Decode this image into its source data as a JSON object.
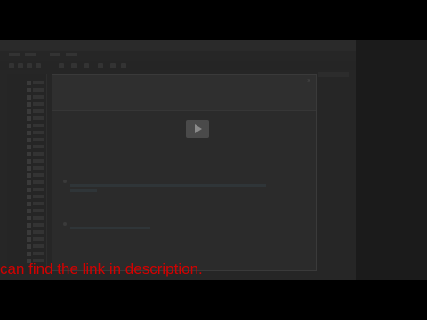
{
  "window": {
    "title": ""
  },
  "menu": [],
  "dialog": {
    "title": "",
    "heading": "",
    "options": [
      {
        "title": "",
        "description": ""
      },
      {
        "title": "",
        "description": ""
      }
    ],
    "finish_label": ""
  },
  "caption": {
    "text": "can find the link in description."
  },
  "colors": {
    "caption": "#d40000",
    "overlay": "#000000"
  },
  "icons": {
    "play": "play-icon",
    "close": "close-icon"
  }
}
